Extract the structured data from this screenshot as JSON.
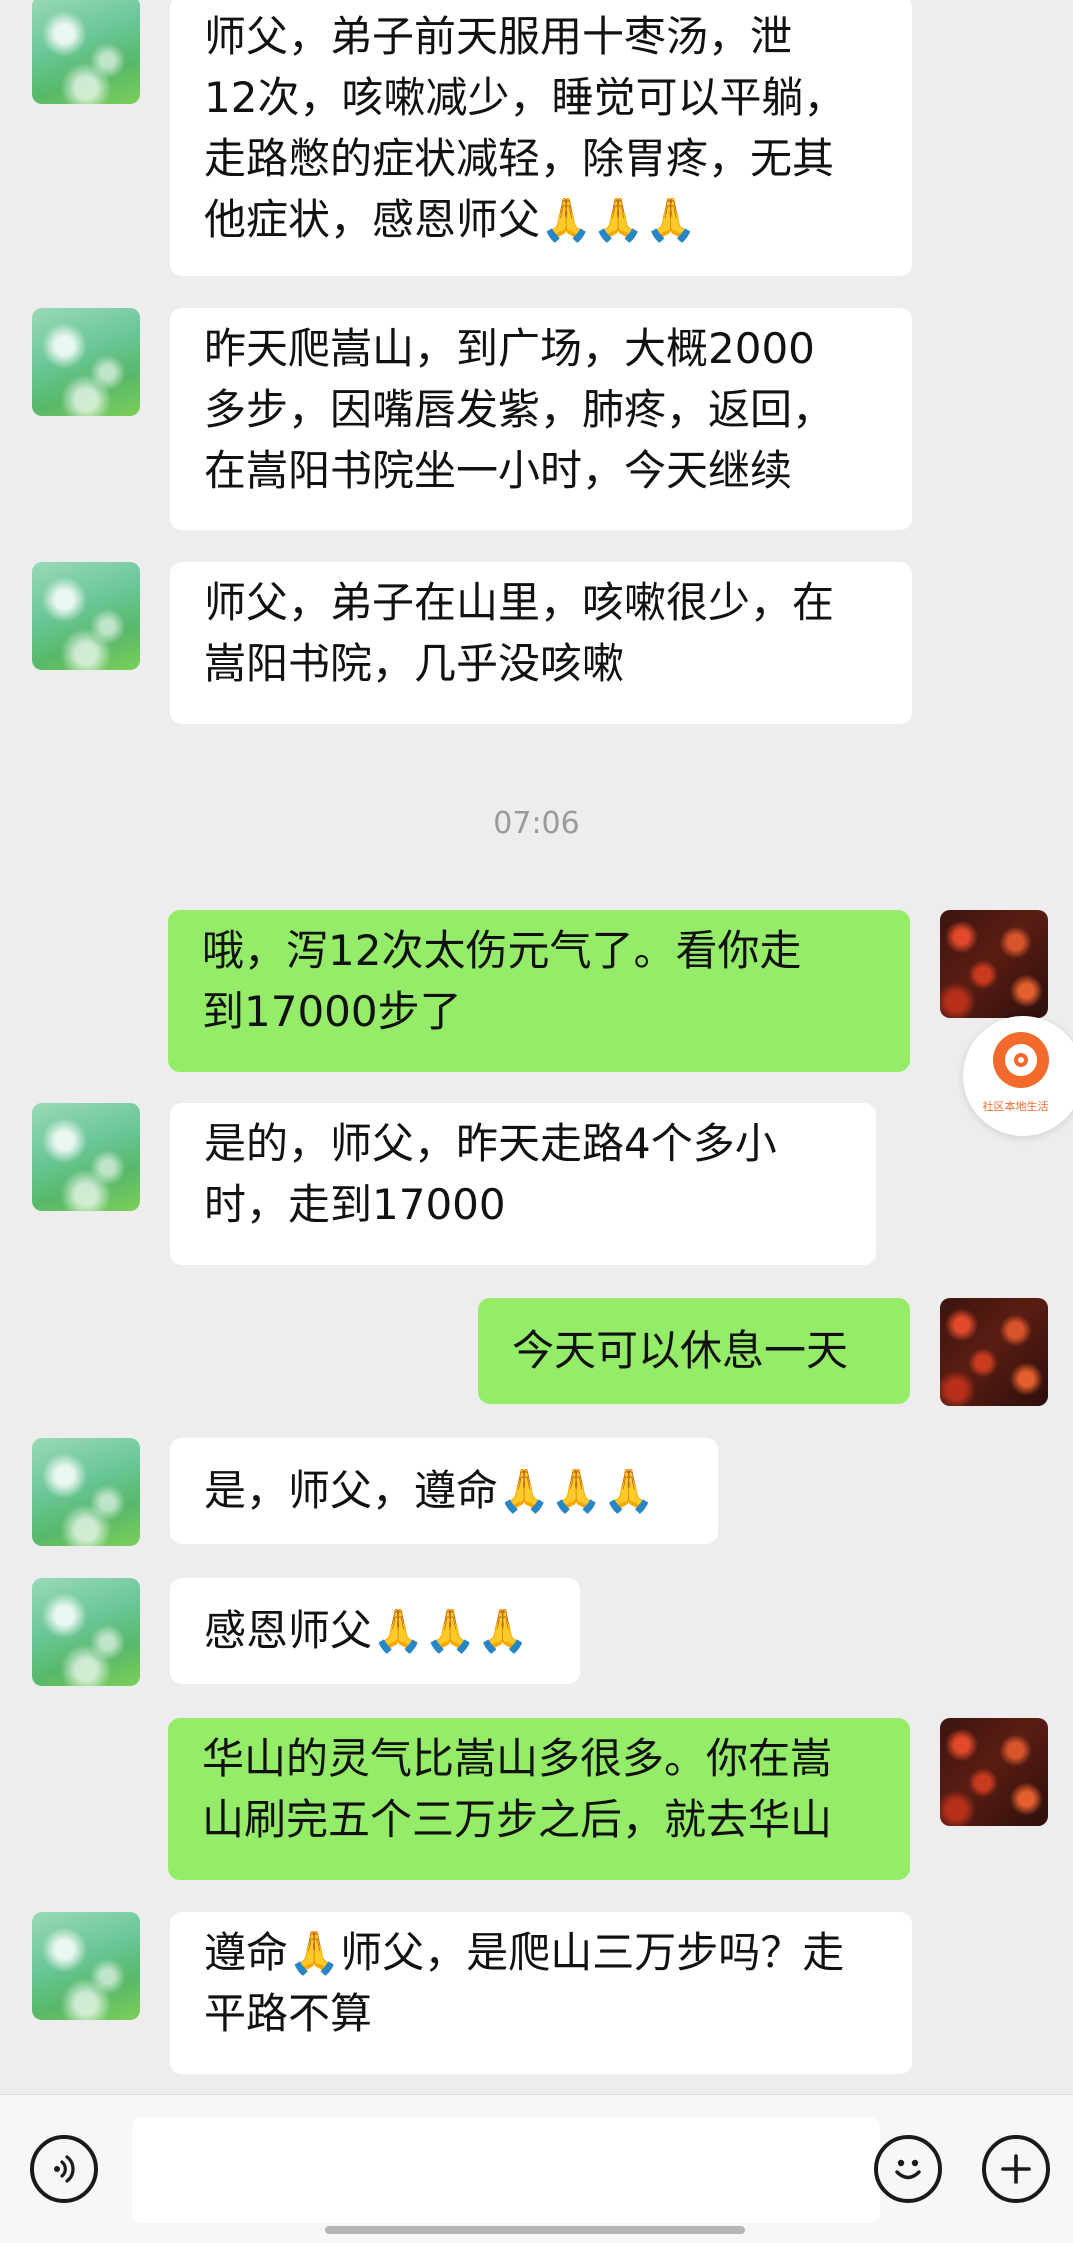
{
  "messages": [
    {
      "side": "in",
      "text": "师父，弟子前天服用十枣汤，泄\n12次，咳嗽减少，睡觉可以平躺，\n走路憋的症状减轻，除胃疼，无其\n他症状，感恩师父🙏🙏🙏"
    },
    {
      "side": "in",
      "text": "昨天爬嵩山，到广场，大概2000\n多步，因嘴唇发紫，肺疼，返回，\n在嵩阳书院坐一小时，今天继续"
    },
    {
      "side": "in",
      "text": "师父，弟子在山里，咳嗽很少，在\n嵩阳书院，几乎没咳嗽"
    },
    {
      "side": "out",
      "text": "哦，泻12次太伤元气了。看你走\n到17000步了"
    },
    {
      "side": "in",
      "text": "是的，师父，昨天走路4个多小\n时，走到17000"
    },
    {
      "side": "out",
      "text": "今天可以休息一天"
    },
    {
      "side": "in",
      "text": "是，师父，遵命🙏🙏🙏"
    },
    {
      "side": "in",
      "text": "感恩师父🙏🙏🙏"
    },
    {
      "side": "out",
      "text": "华山的灵气比嵩山多很多。你在嵩\n山刷完五个三万步之后，就去华山"
    },
    {
      "side": "in",
      "text": "遵命🙏师父，是爬山三万步吗？走\n平路不算"
    }
  ],
  "timestamp": "07:06",
  "floating_widget": {
    "label": "社区本地生活",
    "icon": "location-at-icon"
  },
  "input_bar": {
    "voice_icon": "voice-icon",
    "emoji_icon": "emoji-icon",
    "plus_icon": "plus-icon",
    "input_value": ""
  },
  "colors": {
    "incoming": "#ffffff",
    "outgoing": "#95ec69",
    "background": "#ededed"
  }
}
